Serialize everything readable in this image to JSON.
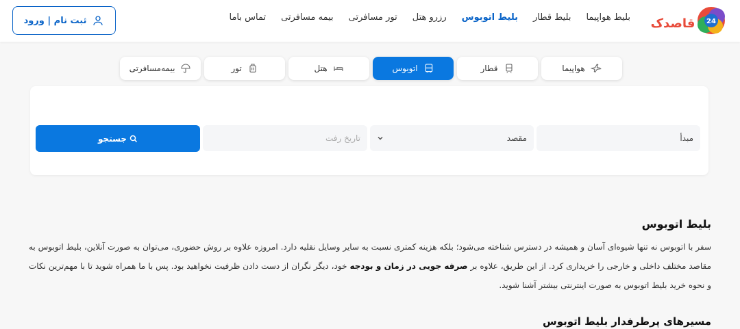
{
  "header": {
    "logo_text": "قاصدک",
    "logo_badge": "24",
    "nav": [
      {
        "label": "بلیط هواپیما",
        "active": false
      },
      {
        "label": "بلیط قطار",
        "active": false
      },
      {
        "label": "بلیط اتوبوس",
        "active": true
      },
      {
        "label": "رزرو هتل",
        "active": false
      },
      {
        "label": "تور مسافرتی",
        "active": false
      },
      {
        "label": "بیمه مسافرتی",
        "active": false
      },
      {
        "label": "تماس باما",
        "active": false
      }
    ],
    "login_label": "ثبت نام | ورود"
  },
  "tabs": [
    {
      "label": "هواپیما",
      "icon": "airplane-icon",
      "active": false
    },
    {
      "label": "قطار",
      "icon": "train-icon",
      "active": false
    },
    {
      "label": "اتوبوس",
      "icon": "bus-icon",
      "active": true
    },
    {
      "label": "هتل",
      "icon": "bed-icon",
      "active": false
    },
    {
      "label": "تور",
      "icon": "luggage-icon",
      "active": false
    },
    {
      "label": "بیمه‌مسافرتی",
      "icon": "umbrella-icon",
      "active": false
    }
  ],
  "search": {
    "origin_placeholder": "مبدأ",
    "destination_label": "مقصد",
    "date_placeholder": "تاریخ رفت",
    "button_label": "جستجو"
  },
  "content": {
    "title": "بلیط اتوبوس",
    "para_1": "سفر با اتوبوس نه تنها شیوه‌ای آسان و همیشه در دسترس شناخته می‌شود؛ بلکه هزینه کمتری نسبت به سایر وسایل نقلیه دارد. امروزه علاوه بر روش حضوری، می‌توان به صورت آنلاین، بلیط اتوبوس به مقاصد مختلف داخلی و خارجی را خریداری کرد. از این طریق، علاوه بر ",
    "para_bold": "صرفه جویی در زمان و بودجه",
    "para_2": " خود، دیگر نگران از دست دادن ظرفیت نخواهید بود. پس با ما همراه شوید تا با مهم‌ترین نکات و نحوه خرید بلیط اتوبوس به صورت اینترنتی بیشتر آشنا شوید.",
    "subtitle": "مسیرهای پرطرفدار بلیط اتوبوس"
  },
  "colors": {
    "primary": "#0a78e0",
    "nav_active": "#0a64c8"
  }
}
